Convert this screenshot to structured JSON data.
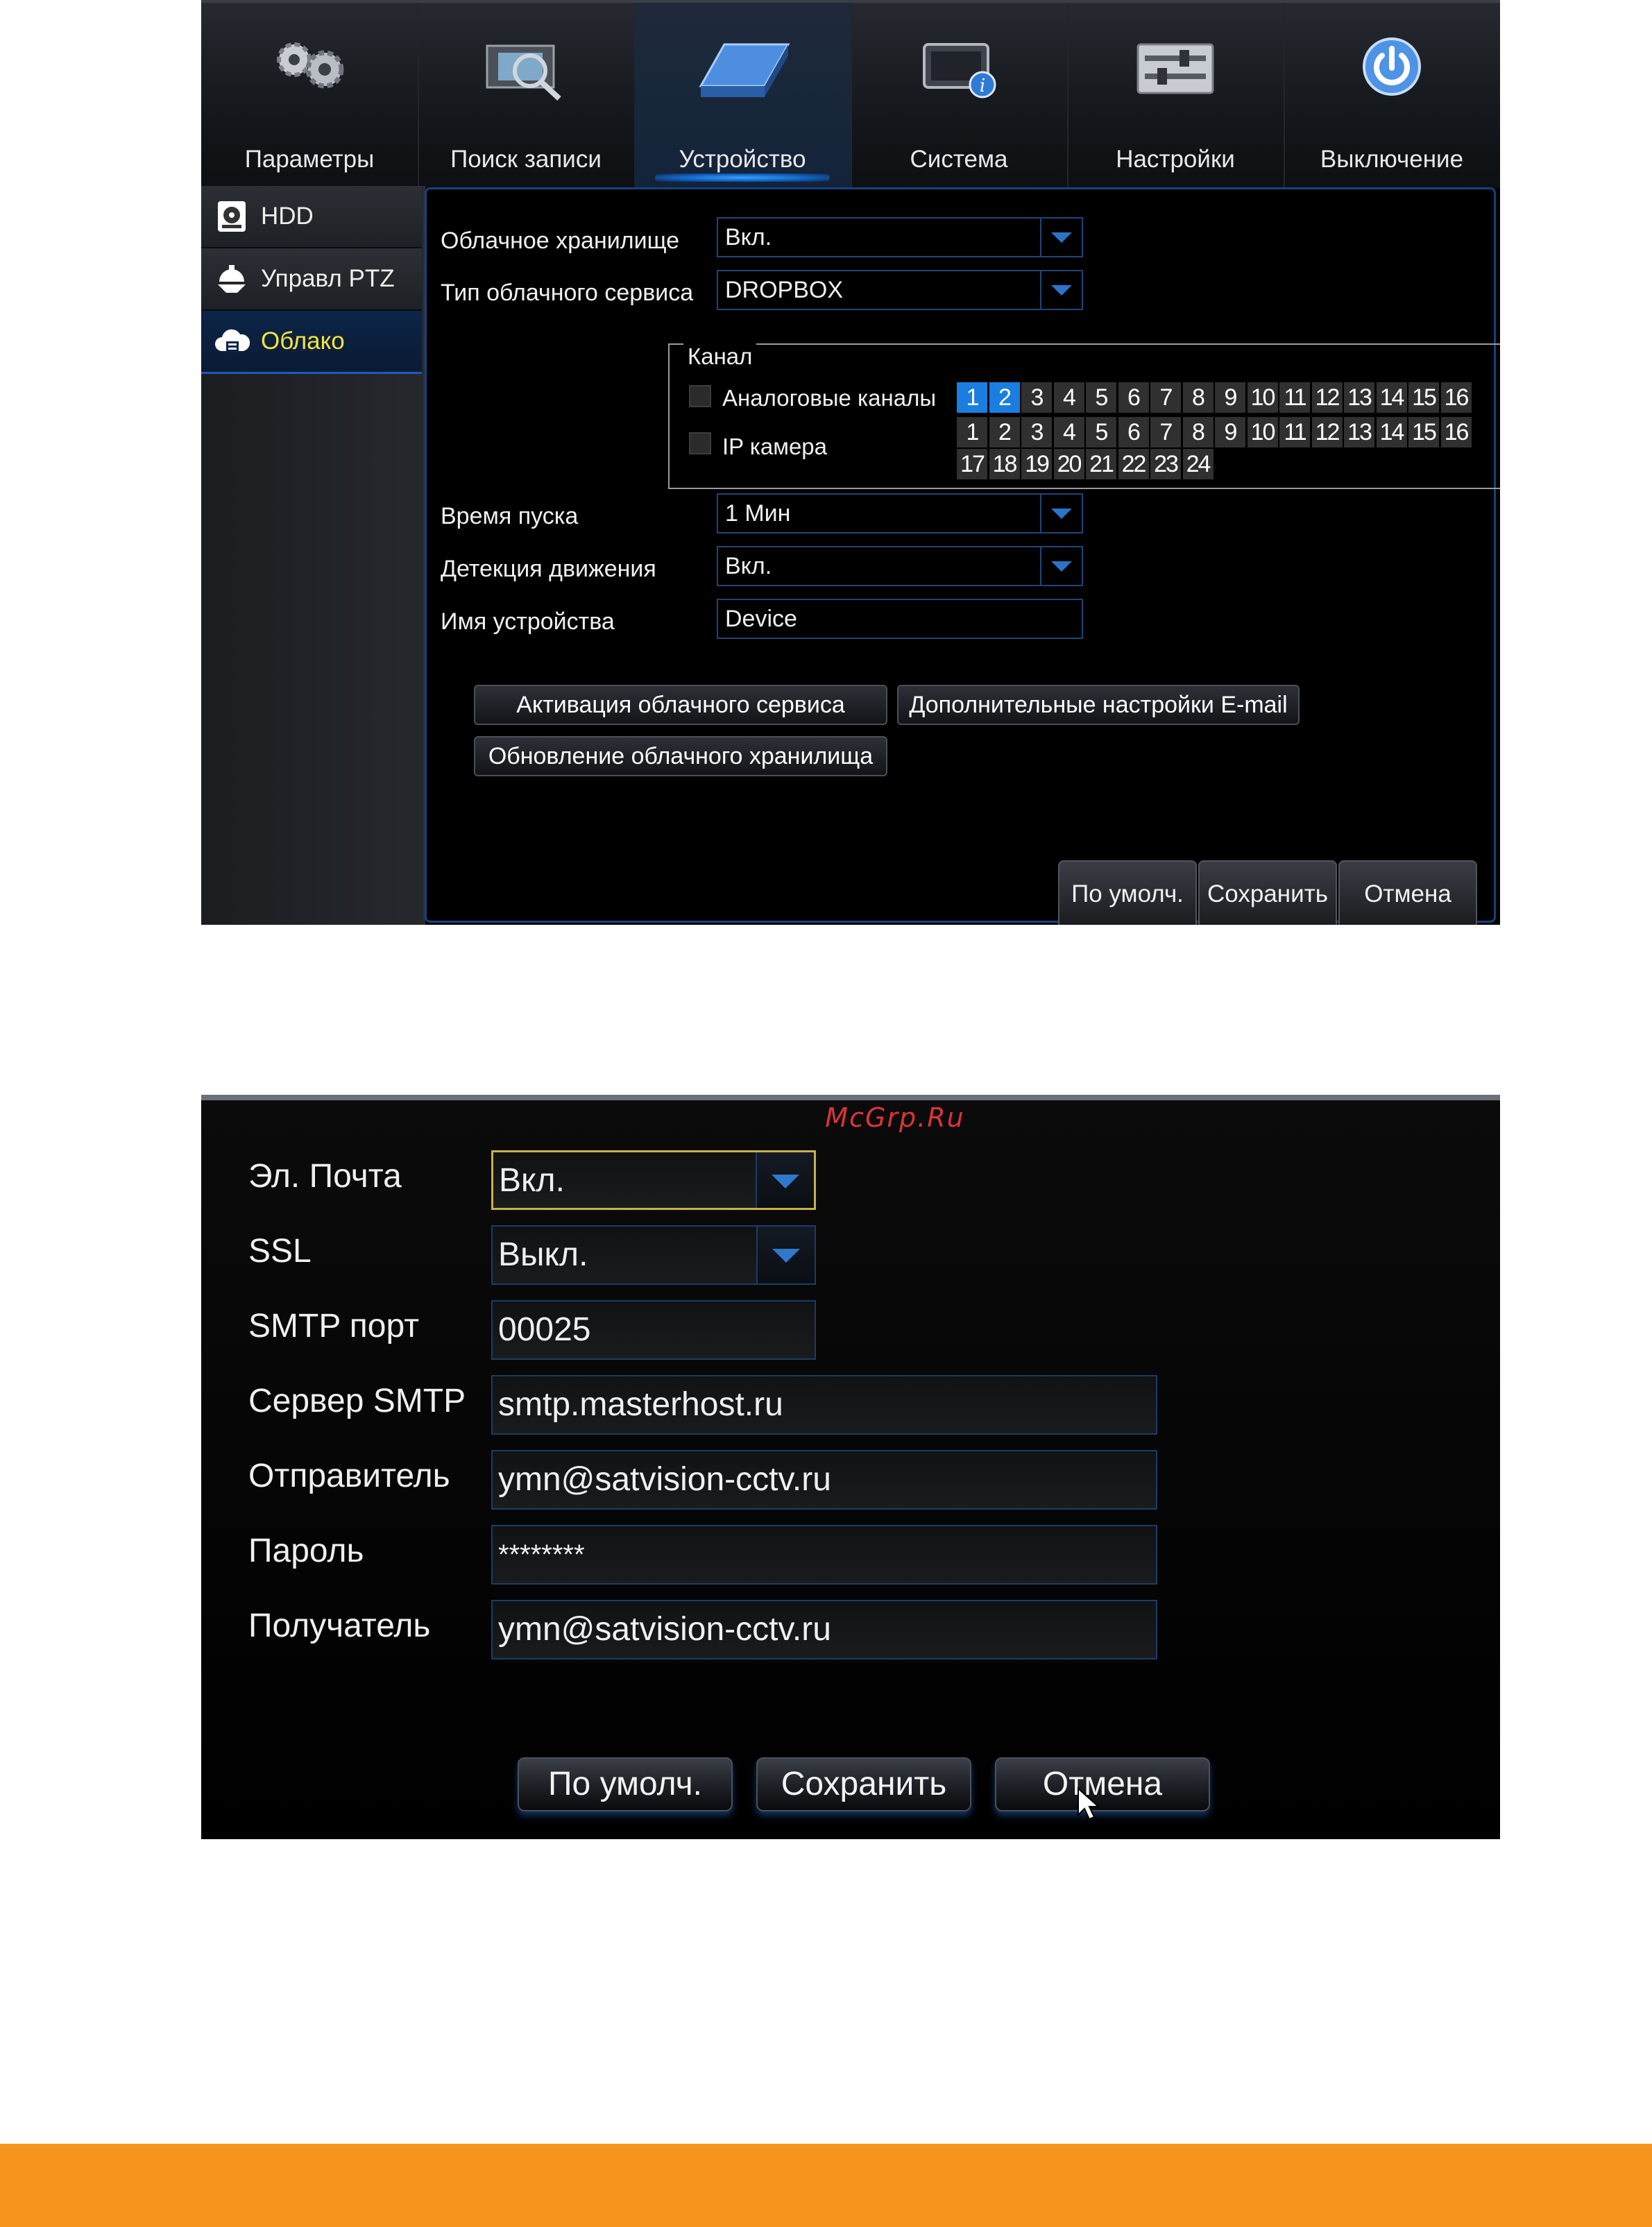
{
  "device_menu": {
    "nav_tabs": [
      {
        "label": "Параметры",
        "icon": "gears-icon"
      },
      {
        "label": "Поиск записи",
        "icon": "film-search-icon"
      },
      {
        "label": "Устройство",
        "icon": "hdd-device-icon"
      },
      {
        "label": "Система",
        "icon": "system-info-icon"
      },
      {
        "label": "Настройки",
        "icon": "sliders-icon"
      },
      {
        "label": "Выключение",
        "icon": "power-icon"
      }
    ],
    "active_tab": "Устройство",
    "sidebar": [
      {
        "label": "HDD",
        "icon": "hdd-icon"
      },
      {
        "label": "Управл PTZ",
        "icon": "ptz-camera-icon"
      },
      {
        "label": "Облако",
        "icon": "cloud-icon"
      }
    ],
    "active_sidebar": "Облако",
    "form": {
      "cloud_storage": {
        "label": "Облачное хранилище",
        "value": "Вкл."
      },
      "cloud_service_type": {
        "label": "Тип облачного сервиса",
        "value": "DROPBOX"
      },
      "start_time": {
        "label": "Время пуска",
        "value": "1 Мин"
      },
      "motion_detection": {
        "label": "Детекция движения",
        "value": "Вкл."
      },
      "device_name": {
        "label": "Имя устройства",
        "value": "Device"
      }
    },
    "channel": {
      "title": "Канал",
      "analog_label": "Аналоговые каналы",
      "ip_label": "IP камера",
      "analog_numbers": [
        "1",
        "2",
        "3",
        "4",
        "5",
        "6",
        "7",
        "8",
        "9",
        "10",
        "11",
        "12",
        "13",
        "14",
        "15",
        "16"
      ],
      "analog_selected": [
        "1",
        "2"
      ],
      "ip_numbers_row1": [
        "1",
        "2",
        "3",
        "4",
        "5",
        "6",
        "7",
        "8",
        "9",
        "10",
        "11",
        "12",
        "13",
        "14",
        "15",
        "16"
      ],
      "ip_numbers_row2": [
        "17",
        "18",
        "19",
        "20",
        "21",
        "22",
        "23",
        "24"
      ]
    },
    "buttons": {
      "activate": "Активация облачного сервиса",
      "email_settings": "Дополнительные настройки E-mail",
      "update_storage": "Обновление облачного хранилища",
      "default": "По умолч.",
      "save": "Сохранить",
      "cancel": "Отмена"
    }
  },
  "email_menu": {
    "watermark": "McGrp.Ru",
    "fields": {
      "email": {
        "label": "Эл. Почта",
        "value": "Вкл."
      },
      "ssl": {
        "label": "SSL",
        "value": "Выкл."
      },
      "smtp_port": {
        "label": "SMTP порт",
        "value": "00025"
      },
      "smtp_server": {
        "label": "Сервер SMTP",
        "value": "smtp.masterhost.ru"
      },
      "sender": {
        "label": "Отправитель",
        "value": "ymn@satvision-cctv.ru"
      },
      "password": {
        "label": "Пароль",
        "value": "********"
      },
      "recipient": {
        "label": "Получатель",
        "value": "ymn@satvision-cctv.ru"
      }
    },
    "buttons": {
      "default": "По умолч.",
      "save": "Сохранить",
      "cancel": "Отмена"
    }
  },
  "colors": {
    "accent_blue": "#1a7ee0",
    "active_sidebar_text": "#f3e340",
    "footer_orange": "#f7941e"
  }
}
